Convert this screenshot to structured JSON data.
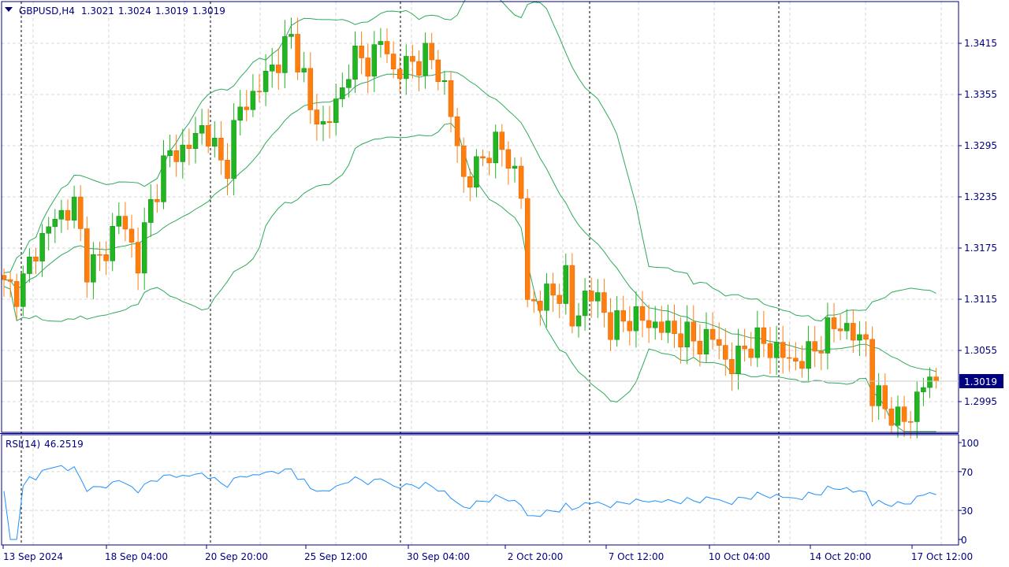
{
  "header": {
    "symbol": "GBPUSD,H4",
    "open": "1.3021",
    "high": "1.3024",
    "low": "1.3019",
    "close": "1.3019"
  },
  "rsi_header": {
    "label": "RSI(14)",
    "value": "46.2519"
  },
  "colors": {
    "bull": "#22b522",
    "bear": "#ff7f0e",
    "band": "#2eaa5a",
    "rsi": "#1e90ff",
    "axis": "#000080",
    "grid": "#d8d8d8"
  },
  "chart_data": [
    {
      "type": "candlestick",
      "title": "GBPUSD,H4",
      "price_ticks": [
        "1.3415",
        "1.3355",
        "1.3295",
        "1.3235",
        "1.3175",
        "1.3115",
        "1.3055",
        "1.2995"
      ],
      "current_price": "1.3019",
      "x_tick_labels": [
        "13 Sep 2024",
        "18 Sep 04:00",
        "20 Sep 20:00",
        "25 Sep 12:00",
        "30 Sep 04:00",
        "2 Oct 20:00",
        "7 Oct 12:00",
        "10 Oct 04:00",
        "14 Oct 20:00",
        "17 Oct 12:00"
      ],
      "ylim": [
        1.2975,
        1.3455
      ],
      "candle_count": 147,
      "close_path": [
        [
          0,
          1.313
        ],
        [
          2.5,
          1.3125
        ],
        [
          5,
          1.3175
        ],
        [
          8,
          1.321
        ],
        [
          11,
          1.3225
        ],
        [
          13,
          1.3155
        ],
        [
          15.4,
          1.316
        ],
        [
          17.9,
          1.3215
        ],
        [
          21,
          1.316
        ],
        [
          22.8,
          1.322
        ],
        [
          25.3,
          1.328
        ],
        [
          29,
          1.3295
        ],
        [
          31.5,
          1.332
        ],
        [
          34.6,
          1.326
        ],
        [
          36.4,
          1.333
        ],
        [
          40.1,
          1.3365
        ],
        [
          43.2,
          1.34
        ],
        [
          45,
          1.342
        ],
        [
          46.9,
          1.338
        ],
        [
          48.1,
          1.333
        ],
        [
          50,
          1.332
        ],
        [
          52.5,
          1.3345
        ],
        [
          54.3,
          1.34
        ],
        [
          56.8,
          1.339
        ],
        [
          59.3,
          1.342
        ],
        [
          61.1,
          1.338
        ],
        [
          63.6,
          1.339
        ],
        [
          66,
          1.34
        ],
        [
          68.5,
          1.338
        ],
        [
          70,
          1.333
        ],
        [
          72.2,
          1.325
        ],
        [
          74.7,
          1.3275
        ],
        [
          76.5,
          1.33
        ],
        [
          79,
          1.328
        ],
        [
          80.9,
          1.325
        ],
        [
          81.9,
          1.311
        ],
        [
          84,
          1.3115
        ],
        [
          86.4,
          1.312
        ],
        [
          88,
          1.314
        ],
        [
          88.9,
          1.308
        ],
        [
          90.7,
          1.312
        ],
        [
          93.2,
          1.3115
        ],
        [
          95.1,
          1.308
        ],
        [
          98.1,
          1.3095
        ],
        [
          101.9,
          1.3085
        ],
        [
          105.6,
          1.3075
        ],
        [
          108.6,
          1.3065
        ],
        [
          111.7,
          1.307
        ],
        [
          113.6,
          1.303
        ],
        [
          116,
          1.306
        ],
        [
          119.1,
          1.3065
        ],
        [
          121.6,
          1.305
        ],
        [
          124.7,
          1.304
        ],
        [
          127.2,
          1.306
        ],
        [
          129,
          1.3075
        ],
        [
          130.9,
          1.309
        ],
        [
          132.7,
          1.307
        ],
        [
          135.2,
          1.307
        ],
        [
          135.8,
          1.3
        ],
        [
          137.7,
          1.2995
        ],
        [
          140.1,
          1.297
        ],
        [
          142,
          1.298
        ],
        [
          143.8,
          1.3015
        ],
        [
          146.3,
          1.302
        ],
        [
          146.9,
          1.3019
        ]
      ],
      "bollinger": {
        "period": 20,
        "deviations": 2
      }
    },
    {
      "type": "line",
      "title": "RSI(14)",
      "last_value": 46.2519,
      "y_ticks": [
        "100",
        "70",
        "30",
        "0"
      ],
      "ylim": [
        0,
        100
      ]
    }
  ]
}
